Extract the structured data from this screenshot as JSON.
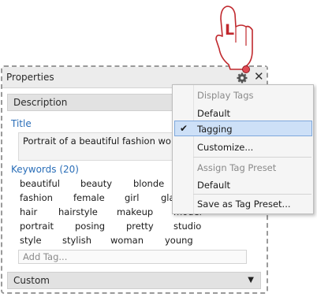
{
  "panel": {
    "title": "Properties",
    "description_section": "Description",
    "custom_section": "Custom"
  },
  "title_field": {
    "label": "Title",
    "value": "Portrait of a beautiful  fashion woman makeup"
  },
  "keywords": {
    "label": "Keywords (20)",
    "rows": [
      [
        "beautiful",
        "beauty",
        "blonde"
      ],
      [
        "fashion",
        "female",
        "girl",
        "gla"
      ],
      [
        "hair",
        "hairstyle",
        "makeup",
        "model"
      ],
      [
        "portrait",
        "posing",
        "pretty",
        "studio"
      ],
      [
        "style",
        "stylish",
        "woman",
        "young"
      ]
    ],
    "add_placeholder": "Add Tag..."
  },
  "menu": {
    "header_display": "Display Tags",
    "item_default_1": "Default",
    "item_tagging": "Tagging",
    "item_customize": "Customize...",
    "header_assign": "Assign Tag Preset",
    "item_default_2": "Default",
    "item_save_preset": "Save as Tag Preset...",
    "checkmark": "✔"
  },
  "cursor": {
    "badge_letter": "L",
    "accent": "#c0282d"
  },
  "colors": {
    "label_blue": "#2a6eb8",
    "highlight": "#cde0f7"
  }
}
